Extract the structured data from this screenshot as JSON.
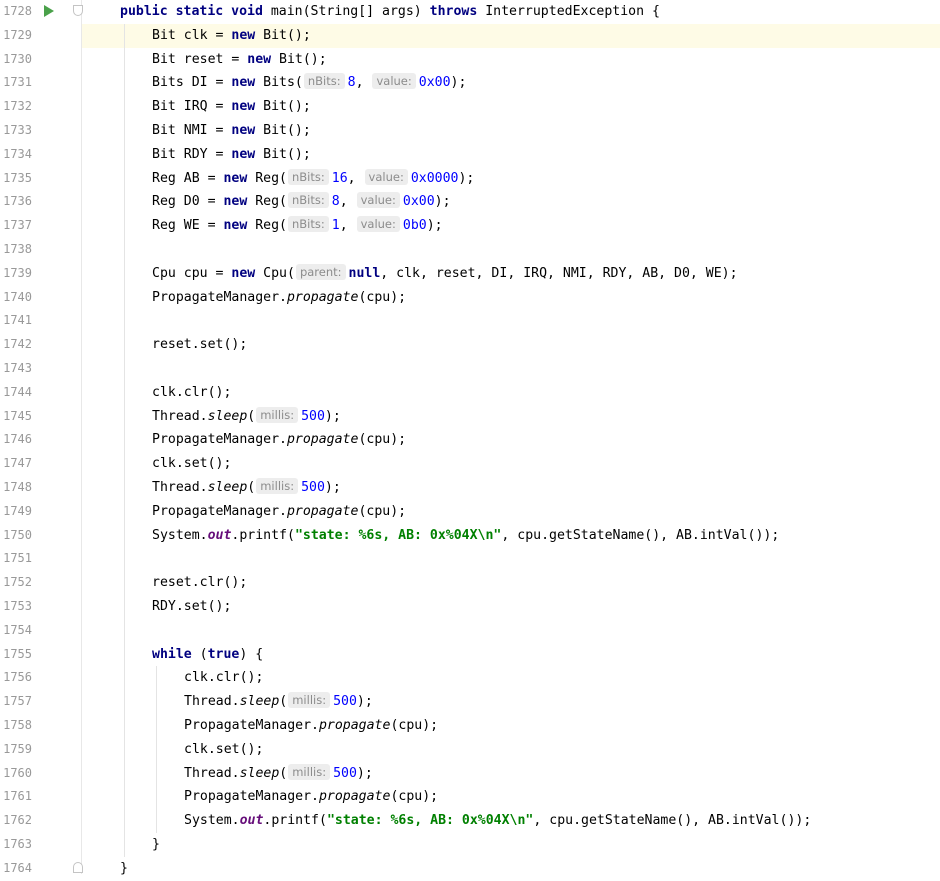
{
  "editor": {
    "current_line": "1729",
    "lines": [
      {
        "no": "1728",
        "indent": 1,
        "run": true,
        "fold": "open",
        "tokens": [
          {
            "t": "kw",
            "v": "public static void "
          },
          {
            "t": "p",
            "v": "main(String[] args) "
          },
          {
            "t": "kw",
            "v": "throws "
          },
          {
            "t": "p",
            "v": "InterruptedException {"
          }
        ]
      },
      {
        "no": "1729",
        "indent": 2,
        "tokens": [
          {
            "t": "p",
            "v": "Bit clk = "
          },
          {
            "t": "kw",
            "v": "new "
          },
          {
            "t": "p",
            "v": "Bit();"
          }
        ]
      },
      {
        "no": "1730",
        "indent": 2,
        "tokens": [
          {
            "t": "p",
            "v": "Bit reset = "
          },
          {
            "t": "kw",
            "v": "new "
          },
          {
            "t": "p",
            "v": "Bit();"
          }
        ]
      },
      {
        "no": "1731",
        "indent": 2,
        "tokens": [
          {
            "t": "p",
            "v": "Bits DI = "
          },
          {
            "t": "kw",
            "v": "new "
          },
          {
            "t": "p",
            "v": "Bits("
          },
          {
            "t": "hint",
            "v": "nBits:"
          },
          {
            "t": "num",
            "v": "8"
          },
          {
            "t": "p",
            "v": ", "
          },
          {
            "t": "hint",
            "v": "value:"
          },
          {
            "t": "num",
            "v": "0x00"
          },
          {
            "t": "p",
            "v": ");"
          }
        ]
      },
      {
        "no": "1732",
        "indent": 2,
        "tokens": [
          {
            "t": "p",
            "v": "Bit IRQ = "
          },
          {
            "t": "kw",
            "v": "new "
          },
          {
            "t": "p",
            "v": "Bit();"
          }
        ]
      },
      {
        "no": "1733",
        "indent": 2,
        "tokens": [
          {
            "t": "p",
            "v": "Bit NMI = "
          },
          {
            "t": "kw",
            "v": "new "
          },
          {
            "t": "p",
            "v": "Bit();"
          }
        ]
      },
      {
        "no": "1734",
        "indent": 2,
        "tokens": [
          {
            "t": "p",
            "v": "Bit RDY = "
          },
          {
            "t": "kw",
            "v": "new "
          },
          {
            "t": "p",
            "v": "Bit();"
          }
        ]
      },
      {
        "no": "1735",
        "indent": 2,
        "tokens": [
          {
            "t": "p",
            "v": "Reg AB = "
          },
          {
            "t": "kw",
            "v": "new "
          },
          {
            "t": "p",
            "v": "Reg("
          },
          {
            "t": "hint",
            "v": "nBits:"
          },
          {
            "t": "num",
            "v": "16"
          },
          {
            "t": "p",
            "v": ", "
          },
          {
            "t": "hint",
            "v": "value:"
          },
          {
            "t": "num",
            "v": "0x0000"
          },
          {
            "t": "p",
            "v": ");"
          }
        ]
      },
      {
        "no": "1736",
        "indent": 2,
        "tokens": [
          {
            "t": "p",
            "v": "Reg D0 = "
          },
          {
            "t": "kw",
            "v": "new "
          },
          {
            "t": "p",
            "v": "Reg("
          },
          {
            "t": "hint",
            "v": "nBits:"
          },
          {
            "t": "num",
            "v": "8"
          },
          {
            "t": "p",
            "v": ", "
          },
          {
            "t": "hint",
            "v": "value:"
          },
          {
            "t": "num",
            "v": "0x00"
          },
          {
            "t": "p",
            "v": ");"
          }
        ]
      },
      {
        "no": "1737",
        "indent": 2,
        "tokens": [
          {
            "t": "p",
            "v": "Reg WE = "
          },
          {
            "t": "kw",
            "v": "new "
          },
          {
            "t": "p",
            "v": "Reg("
          },
          {
            "t": "hint",
            "v": "nBits:"
          },
          {
            "t": "num",
            "v": "1"
          },
          {
            "t": "p",
            "v": ", "
          },
          {
            "t": "hint",
            "v": "value:"
          },
          {
            "t": "num",
            "v": "0b0"
          },
          {
            "t": "p",
            "v": ");"
          }
        ]
      },
      {
        "no": "1738",
        "indent": 2,
        "tokens": []
      },
      {
        "no": "1739",
        "indent": 2,
        "tokens": [
          {
            "t": "p",
            "v": "Cpu cpu = "
          },
          {
            "t": "kw",
            "v": "new "
          },
          {
            "t": "p",
            "v": "Cpu("
          },
          {
            "t": "hint",
            "v": "parent:"
          },
          {
            "t": "kw",
            "v": "null"
          },
          {
            "t": "p",
            "v": ", clk, reset, DI, IRQ, NMI, RDY, AB, D0, WE);"
          }
        ]
      },
      {
        "no": "1740",
        "indent": 2,
        "tokens": [
          {
            "t": "p",
            "v": "PropagateManager."
          },
          {
            "t": "sm",
            "v": "propagate"
          },
          {
            "t": "p",
            "v": "(cpu);"
          }
        ]
      },
      {
        "no": "1741",
        "indent": 2,
        "tokens": []
      },
      {
        "no": "1742",
        "indent": 2,
        "tokens": [
          {
            "t": "p",
            "v": "reset.set();"
          }
        ]
      },
      {
        "no": "1743",
        "indent": 2,
        "tokens": []
      },
      {
        "no": "1744",
        "indent": 2,
        "tokens": [
          {
            "t": "p",
            "v": "clk.clr();"
          }
        ]
      },
      {
        "no": "1745",
        "indent": 2,
        "tokens": [
          {
            "t": "p",
            "v": "Thread."
          },
          {
            "t": "sm",
            "v": "sleep"
          },
          {
            "t": "p",
            "v": "("
          },
          {
            "t": "hint",
            "v": "millis:"
          },
          {
            "t": "num",
            "v": "500"
          },
          {
            "t": "p",
            "v": ");"
          }
        ]
      },
      {
        "no": "1746",
        "indent": 2,
        "tokens": [
          {
            "t": "p",
            "v": "PropagateManager."
          },
          {
            "t": "sm",
            "v": "propagate"
          },
          {
            "t": "p",
            "v": "(cpu);"
          }
        ]
      },
      {
        "no": "1747",
        "indent": 2,
        "tokens": [
          {
            "t": "p",
            "v": "clk.set();"
          }
        ]
      },
      {
        "no": "1748",
        "indent": 2,
        "tokens": [
          {
            "t": "p",
            "v": "Thread."
          },
          {
            "t": "sm",
            "v": "sleep"
          },
          {
            "t": "p",
            "v": "("
          },
          {
            "t": "hint",
            "v": "millis:"
          },
          {
            "t": "num",
            "v": "500"
          },
          {
            "t": "p",
            "v": ");"
          }
        ]
      },
      {
        "no": "1749",
        "indent": 2,
        "tokens": [
          {
            "t": "p",
            "v": "PropagateManager."
          },
          {
            "t": "sm",
            "v": "propagate"
          },
          {
            "t": "p",
            "v": "(cpu);"
          }
        ]
      },
      {
        "no": "1750",
        "indent": 2,
        "tokens": [
          {
            "t": "p",
            "v": "System."
          },
          {
            "t": "sf",
            "v": "out"
          },
          {
            "t": "p",
            "v": ".printf("
          },
          {
            "t": "str",
            "v": "\"state: %6s, AB: 0x%04X\\n\""
          },
          {
            "t": "p",
            "v": ", cpu.getStateName(), AB.intVal());"
          }
        ]
      },
      {
        "no": "1751",
        "indent": 2,
        "tokens": []
      },
      {
        "no": "1752",
        "indent": 2,
        "tokens": [
          {
            "t": "p",
            "v": "reset.clr();"
          }
        ]
      },
      {
        "no": "1753",
        "indent": 2,
        "tokens": [
          {
            "t": "p",
            "v": "RDY.set();"
          }
        ]
      },
      {
        "no": "1754",
        "indent": 2,
        "tokens": []
      },
      {
        "no": "1755",
        "indent": 2,
        "tokens": [
          {
            "t": "kw",
            "v": "while "
          },
          {
            "t": "p",
            "v": "("
          },
          {
            "t": "kw",
            "v": "true"
          },
          {
            "t": "p",
            "v": ") {"
          }
        ]
      },
      {
        "no": "1756",
        "indent": 3,
        "tokens": [
          {
            "t": "p",
            "v": "clk.clr();"
          }
        ]
      },
      {
        "no": "1757",
        "indent": 3,
        "tokens": [
          {
            "t": "p",
            "v": "Thread."
          },
          {
            "t": "sm",
            "v": "sleep"
          },
          {
            "t": "p",
            "v": "("
          },
          {
            "t": "hint",
            "v": "millis:"
          },
          {
            "t": "num",
            "v": "500"
          },
          {
            "t": "p",
            "v": ");"
          }
        ]
      },
      {
        "no": "1758",
        "indent": 3,
        "tokens": [
          {
            "t": "p",
            "v": "PropagateManager."
          },
          {
            "t": "sm",
            "v": "propagate"
          },
          {
            "t": "p",
            "v": "(cpu);"
          }
        ]
      },
      {
        "no": "1759",
        "indent": 3,
        "tokens": [
          {
            "t": "p",
            "v": "clk.set();"
          }
        ]
      },
      {
        "no": "1760",
        "indent": 3,
        "tokens": [
          {
            "t": "p",
            "v": "Thread."
          },
          {
            "t": "sm",
            "v": "sleep"
          },
          {
            "t": "p",
            "v": "("
          },
          {
            "t": "hint",
            "v": "millis:"
          },
          {
            "t": "num",
            "v": "500"
          },
          {
            "t": "p",
            "v": ");"
          }
        ]
      },
      {
        "no": "1761",
        "indent": 3,
        "tokens": [
          {
            "t": "p",
            "v": "PropagateManager."
          },
          {
            "t": "sm",
            "v": "propagate"
          },
          {
            "t": "p",
            "v": "(cpu);"
          }
        ]
      },
      {
        "no": "1762",
        "indent": 3,
        "tokens": [
          {
            "t": "p",
            "v": "System."
          },
          {
            "t": "sf",
            "v": "out"
          },
          {
            "t": "p",
            "v": ".printf("
          },
          {
            "t": "str",
            "v": "\"state: %6s, AB: 0x%04X\\n\""
          },
          {
            "t": "p",
            "v": ", cpu.getStateName(), AB.intVal());"
          }
        ]
      },
      {
        "no": "1763",
        "indent": 2,
        "tokens": [
          {
            "t": "p",
            "v": "}"
          }
        ]
      },
      {
        "no": "1764",
        "indent": 1,
        "fold": "close",
        "tokens": [
          {
            "t": "p",
            "v": "}"
          }
        ]
      }
    ]
  },
  "colors": {
    "keyword": "#000080",
    "string": "#008000",
    "number": "#0000ff",
    "static_field": "#660e7a",
    "hint_bg": "#ededed",
    "current_line_bg": "#fefbe6",
    "line_number": "#999999"
  },
  "icons": {
    "run": "run-gutter-icon",
    "fold_open": "fold-open-icon",
    "fold_close": "fold-close-icon"
  }
}
